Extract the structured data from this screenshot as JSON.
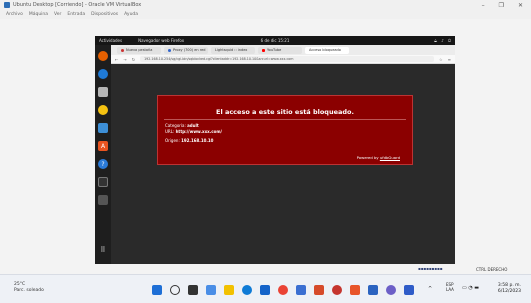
{
  "host": {
    "title": "Ubuntu Desktop [Corriendo] - Oracle VM VirtualBox",
    "menu": [
      "Archivo",
      "Máquina",
      "Ver",
      "Entrada",
      "Dispositivos",
      "Ayuda"
    ],
    "window_controls": [
      "–",
      "❐",
      "✕"
    ]
  },
  "guest": {
    "activities": "Actividades",
    "app_name": "Navegador web Firefox",
    "clock": "6 de dic 15:21",
    "tray": [
      "⟁",
      "♪",
      "⏻"
    ]
  },
  "browser": {
    "tabs": [
      "Nueva pestaña",
      "Proxy (700) en red",
      "Lightsquid :: index",
      "YouTube",
      "Acceso bloqueado"
    ],
    "url": "192.168.10.254/sg/cgi-bin/sqblocked.cgi?clientaddr=192.168.10.10&srcurl=www.xxx.com"
  },
  "block": {
    "title": "El acceso a este sitio está bloqueado.",
    "category_label": "Categoría:",
    "category_value": "adult",
    "url_label": "URL:",
    "url_value": "http://www.xxx.com/",
    "origin_label": "Origen:",
    "origin_value": "192.168.10.10",
    "powered_prefix": "Powered by",
    "powered_link": "ufdbGuard"
  },
  "taskbar": {
    "weather_temp": "25°C",
    "weather_desc": "Parc. soleado",
    "lang1": "ESP",
    "lang2": "LAA",
    "time": "3:58 p. m.",
    "date": "6/12/2023",
    "ctrl": "CTRL DERECHO"
  },
  "colors": {
    "block_bg": "#8b0000",
    "dock_bg": "#1e1e1e"
  }
}
